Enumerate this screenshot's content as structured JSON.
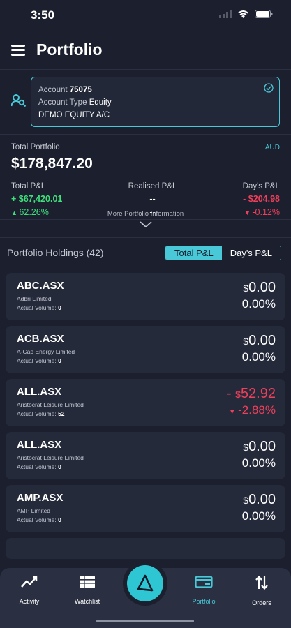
{
  "status_bar": {
    "time": "3:50"
  },
  "header": {
    "title": "Portfolio"
  },
  "account": {
    "label": "Account",
    "number": "75075",
    "type_label": "Account Type",
    "type_value": "Equity",
    "name": "DEMO EQUITY A/C"
  },
  "summary": {
    "total_label": "Total Portfolio",
    "currency": "AUD",
    "total_value": "$178,847.20",
    "total_pnl_label": "Total P&L",
    "total_pnl_value": "$67,420.01",
    "total_pnl_pct": "62.26%",
    "realised_label": "Realised P&L",
    "realised_value": "--",
    "realised_pct": "--",
    "days_label": "Day's P&L",
    "days_value": "- $204.98",
    "days_pct": "-0.12%",
    "more_info": "More Portfolio Information"
  },
  "holdings": {
    "title": "Portfolio Holdings (42)",
    "toggle_total": "Total P&L",
    "toggle_days": "Day's P&L",
    "volume_label": "Actual Volume:",
    "items": [
      {
        "symbol": "ABC.ASX",
        "name": "Adbri Limited",
        "volume": "0",
        "prefix": "",
        "currency": "$",
        "amount": "0.00",
        "pct": "0.00%"
      },
      {
        "symbol": "ACB.ASX",
        "name": "A-Cap Energy Limited",
        "volume": "0",
        "prefix": "",
        "currency": "$",
        "amount": "0.00",
        "pct": "0.00%"
      },
      {
        "symbol": "ALL.ASX",
        "name": "Aristocrat Leisure Limited",
        "volume": "52",
        "prefix": "- ",
        "currency": "$",
        "amount": "52.92",
        "pct": "-2.88%"
      },
      {
        "symbol": "ALL.ASX",
        "name": "Aristocrat Leisure Limited",
        "volume": "0",
        "prefix": "",
        "currency": "$",
        "amount": "0.00",
        "pct": "0.00%"
      },
      {
        "symbol": "AMP.ASX",
        "name": "AMP Limited",
        "volume": "0",
        "prefix": "",
        "currency": "$",
        "amount": "0.00",
        "pct": "0.00%"
      }
    ]
  },
  "tabbar": {
    "activity": "Activity",
    "watchlist": "Watchlist",
    "portfolio": "Portfolio",
    "orders": "Orders"
  },
  "colors": {
    "background": "#1b1f2e",
    "accent": "#49c9d8",
    "positive": "#3ee07a",
    "negative": "#f03f5a"
  }
}
